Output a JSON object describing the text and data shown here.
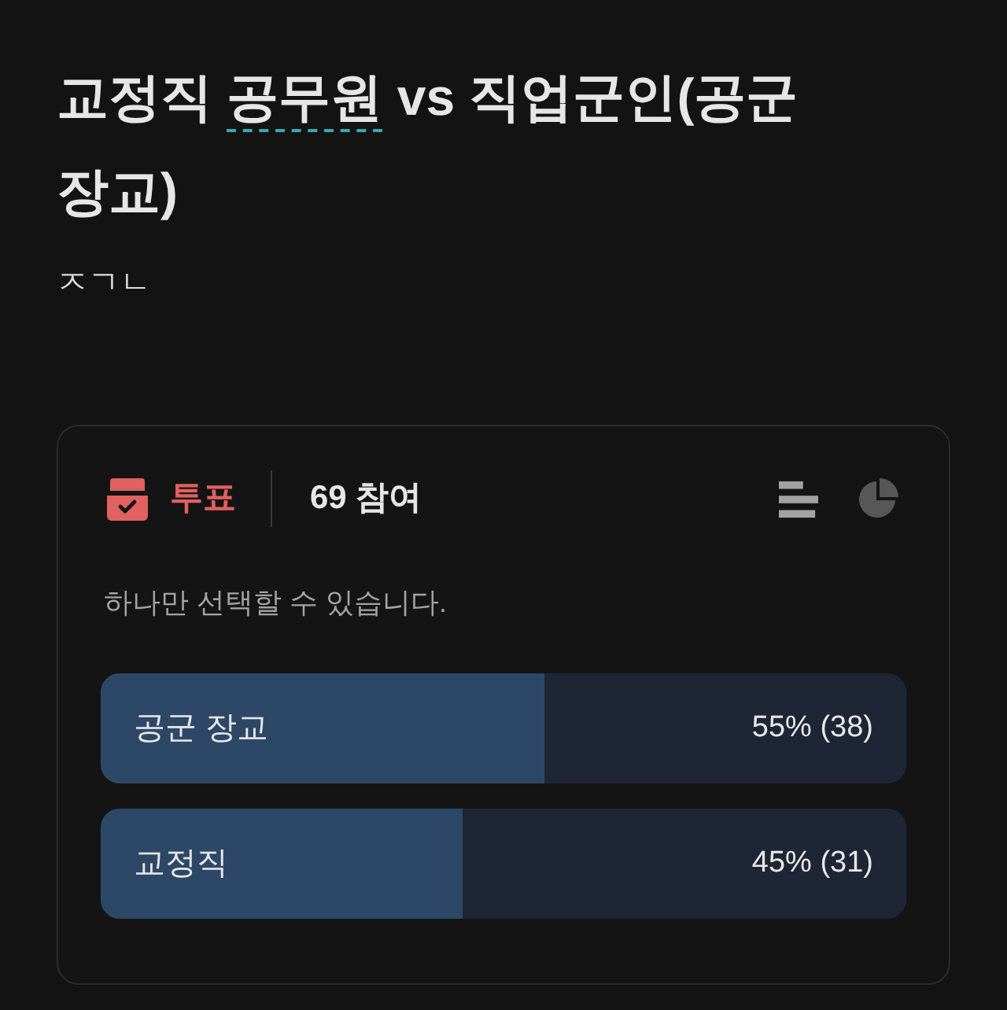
{
  "post": {
    "title": [
      {
        "kind": "text",
        "text": "교정직 "
      },
      {
        "kind": "link",
        "text": "공무원"
      },
      {
        "kind": "text",
        "text": " vs 직업군인(공군 장교)"
      }
    ],
    "body": "ㅈㄱㄴ"
  },
  "poll": {
    "label": "투표",
    "participants": "69 참여",
    "views": [
      {
        "kind": "bars",
        "selected": true
      },
      {
        "kind": "pie",
        "selected": false
      }
    ],
    "hint": "하나만 선택할 수 있습니다.",
    "options": [
      {
        "label": "공군 장교",
        "level": 0.55,
        "reading": "55% (38)"
      },
      {
        "label": "교정직",
        "level": 0.45,
        "reading": "45% (31)"
      }
    ]
  }
}
